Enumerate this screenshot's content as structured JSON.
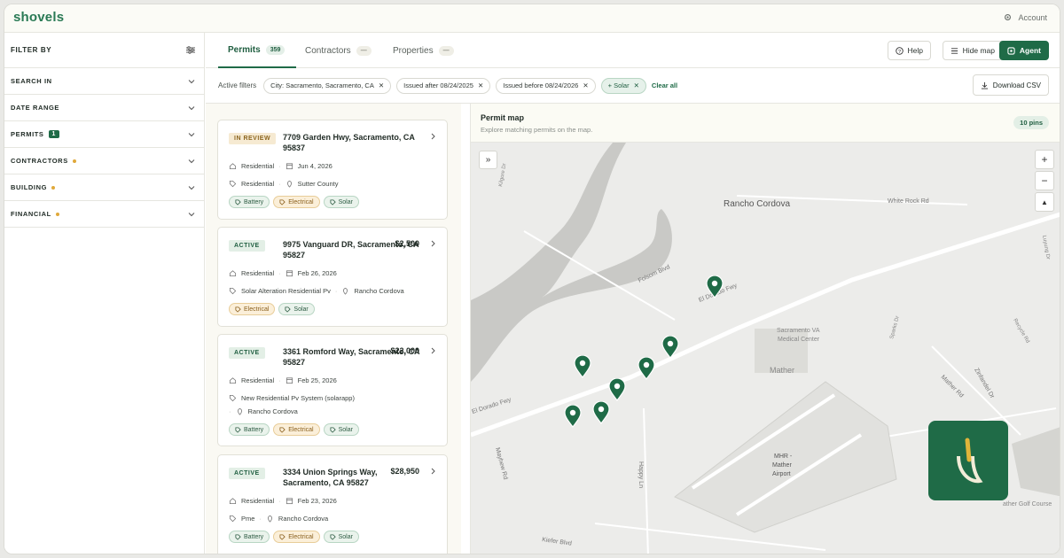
{
  "app": {
    "logo": "shovels",
    "account": "Account"
  },
  "sidebar": {
    "title": "FILTER BY",
    "items": [
      {
        "label": "SEARCH IN",
        "dot": false,
        "badge": ""
      },
      {
        "label": "DATE RANGE",
        "dot": false,
        "badge": ""
      },
      {
        "label": "PERMITS",
        "dot": false,
        "badge": "1"
      },
      {
        "label": "CONTRACTORS",
        "dot": true,
        "badge": ""
      },
      {
        "label": "BUILDING",
        "dot": true,
        "badge": ""
      },
      {
        "label": "FINANCIAL",
        "dot": true,
        "badge": ""
      }
    ]
  },
  "tabs": [
    {
      "label": "Permits",
      "count": "359"
    },
    {
      "label": "Contractors",
      "count": "—"
    },
    {
      "label": "Properties",
      "count": "—"
    }
  ],
  "header_buttons": {
    "help": "Help",
    "hide_map": "Hide map",
    "agent": "Agent"
  },
  "filters": {
    "label": "Active filters",
    "chips": [
      "City: Sacramento, Sacramento, CA",
      "Issued after 08/24/2025",
      "Issued before 08/24/2026",
      "+ Solar"
    ],
    "clear": "Clear all",
    "download": "Download CSV"
  },
  "permits": [
    {
      "status": "IN REVIEW",
      "address": "7709 Garden Hwy, Sacramento, CA 95837",
      "price": "",
      "type": "Residential",
      "date": "Jun 4, 2026",
      "desc": "Residential",
      "location": "Sutter County",
      "tags": [
        "Battery",
        "Electrical",
        "Solar"
      ]
    },
    {
      "status": "ACTIVE",
      "address": "9975 Vanguard DR, Sacramento, CA 95827",
      "price": "$2,500",
      "type": "Residential",
      "date": "Feb 26, 2026",
      "desc": "Solar Alteration Residential Pv",
      "location": "Rancho Cordova",
      "tags": [
        "Electrical",
        "Solar"
      ]
    },
    {
      "status": "ACTIVE",
      "address": "3361 Romford Way, Sacramento, CA 95827",
      "price": "$22,000",
      "type": "Residential",
      "date": "Feb 25, 2026",
      "desc": "New Residential Pv System (solarapp)",
      "location": "Rancho Cordova",
      "tags": [
        "Battery",
        "Electrical",
        "Solar"
      ]
    },
    {
      "status": "ACTIVE",
      "address": "3334 Union Springs Way, Sacramento, CA 95827",
      "price": "$28,950",
      "type": "Residential",
      "date": "Feb 23, 2026",
      "desc": "Pme",
      "location": "Rancho Cordova",
      "tags": [
        "Battery",
        "Electrical",
        "Solar"
      ]
    }
  ],
  "map": {
    "title": "Permit map",
    "subtitle": "Explore matching permits on the map.",
    "pins": "10 pins",
    "labels": {
      "rancho": "Rancho Cordova",
      "white_rock": "White Rock Rd",
      "folsom": "Folsom Blvd",
      "el_dorado_top": "El Dorado Fwy",
      "el_dorado_bottom": "El Dorado Fwy",
      "va": "Sacramento VA",
      "va2": "Medical Center",
      "mather": "Mather",
      "mather_rd": "Mather Rd",
      "zinfandel": "Zinfandel Dr",
      "mayhew": "Mayhew Rd",
      "happy": "Happy Ln",
      "kiefer": "Kiefer Blvd",
      "mhr1": "MHR -",
      "mhr2": "Mather",
      "mhr3": "Airport",
      "golf": "ather Golf Course",
      "kilgore": "Kilgore Dr",
      "recycle": "Recycle Rd",
      "luyung": "Luyung Dr",
      "sparks": "Sparks Dr"
    }
  }
}
